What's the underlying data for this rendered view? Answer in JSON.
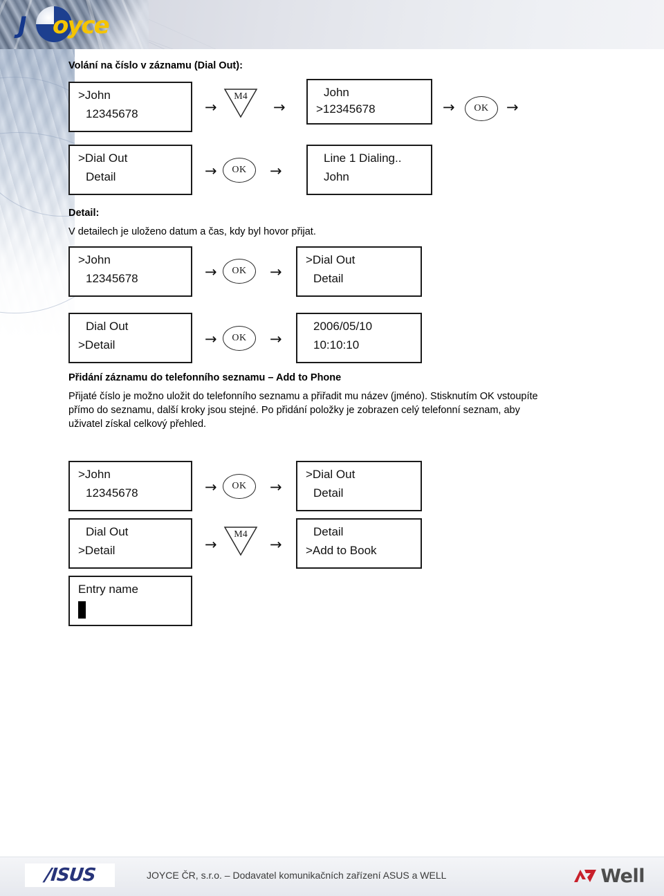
{
  "header": {
    "logo_text": "Joyce",
    "logo_part_blue": "J",
    "logo_part_yellow": "oyce"
  },
  "document": {
    "section1_title": "Volání na číslo v záznamu (Dial Out):",
    "section2_title": "Detail:",
    "section2_paragraph": "V detailech je uloženo datum a čas, kdy byl hovor přijat.",
    "section3_title": "Přidání záznamu do telefonního seznamu – Add to Phone",
    "section3_paragraph_line1": "Přijaté číslo je možno uložit do telefonního seznamu a přiřadit mu název (jméno). Stisknutím OK vstoupíte",
    "section3_paragraph_line2": "přímo do seznamu, další kroky jsou stejné. Po přidání položky je zobrazen celý telefonní seznam, aby",
    "section3_paragraph_line3": "uživatel získal celkový přehled."
  },
  "keys": {
    "ok_label": "OK",
    "m4_label": "M4",
    "arrow_glyph": "→"
  },
  "flow1": {
    "box1": {
      "line1": ">John",
      "line2": "12345678"
    },
    "box2": {
      "line1": "John",
      "line2": ">12345678"
    },
    "box3": {
      "line1": ">Dial Out",
      "line2": "Detail"
    },
    "box4": {
      "line1": "Line 1 Dialing..",
      "line2": "John"
    }
  },
  "flow2": {
    "box1": {
      "line1": ">John",
      "line2": "12345678"
    },
    "box2": {
      "line1": ">Dial Out",
      "line2": "Detail"
    },
    "box3": {
      "line1": "Dial Out",
      "line2": ">Detail"
    },
    "box4": {
      "line1": "2006/05/10",
      "line2": "10:10:10"
    }
  },
  "flow3": {
    "box1": {
      "line1": ">John",
      "line2": "12345678"
    },
    "box2": {
      "line1": ">Dial Out",
      "line2": "Detail"
    },
    "box3": {
      "line1": "Dial Out",
      "line2": ">Detail"
    },
    "box4": {
      "line1": "Detail",
      "line2": ">Add to Book"
    },
    "box5": {
      "line1": "Entry name",
      "line2": ""
    }
  },
  "footer": {
    "asus_label": "/ISUS",
    "text": "JOYCE ČR, s.r.o. – Dodavatel komunikačních zařízení ASUS a WELL",
    "well_label": "Well"
  },
  "colors": {
    "logo_blue": "#15388c",
    "logo_yellow": "#f5c400",
    "asus_blue": "#27347a",
    "well_red": "#c8202b",
    "well_gray": "#4d4d4d",
    "box_border": "#1a1a1a"
  }
}
